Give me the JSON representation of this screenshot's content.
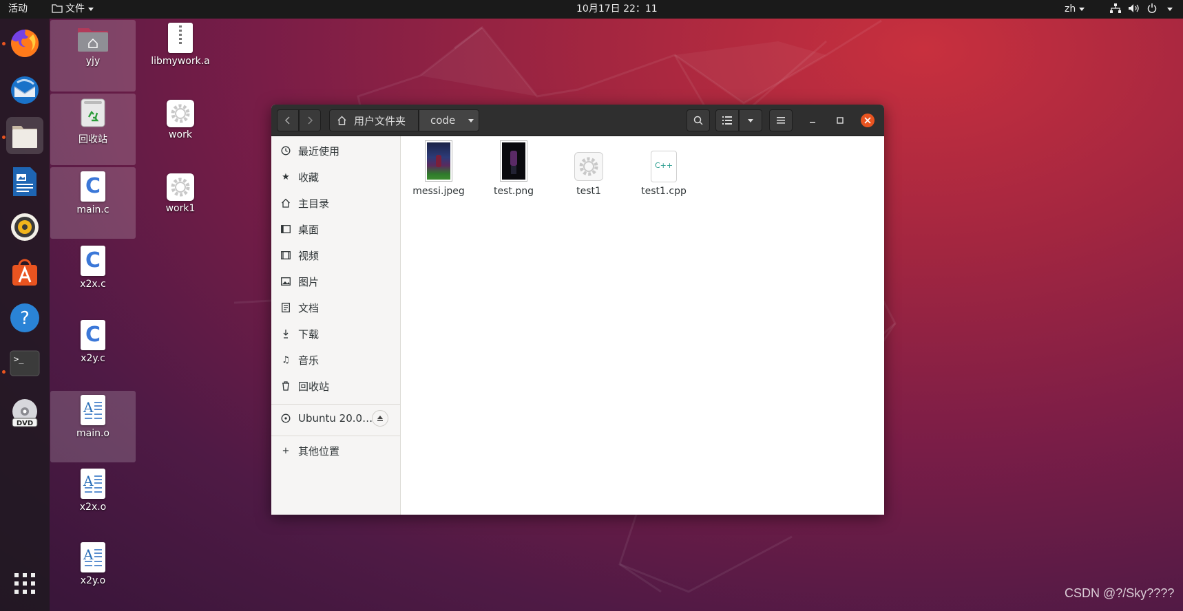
{
  "topbar": {
    "activities": "活动",
    "app_menu": "文件",
    "clock": "10月17日  22：11",
    "input_method": "zh"
  },
  "dock": {
    "items": [
      "firefox-icon",
      "thunderbird-icon",
      "files-icon",
      "writer-icon",
      "rhythmbox-icon",
      "software-icon",
      "help-icon",
      "terminal-icon",
      "dvd-icon"
    ],
    "show_apps": "show-apps-icon"
  },
  "desktop": {
    "items": [
      {
        "label": "yjy",
        "icon": "home-folder-icon"
      },
      {
        "label": "回收站",
        "icon": "trash-icon"
      },
      {
        "label": "main.c",
        "icon": "c-source-icon"
      },
      {
        "label": "x2x.c",
        "icon": "c-source-icon"
      },
      {
        "label": "x2y.c",
        "icon": "c-source-icon"
      },
      {
        "label": "main.o",
        "icon": "object-file-icon"
      },
      {
        "label": "x2x.o",
        "icon": "object-file-icon"
      },
      {
        "label": "x2y.o",
        "icon": "object-file-icon"
      },
      {
        "label": "libmywork.a",
        "icon": "archive-icon"
      },
      {
        "label": "work",
        "icon": "executable-icon"
      },
      {
        "label": "work1",
        "icon": "executable-icon"
      }
    ]
  },
  "window": {
    "path_home": "用户文件夹",
    "path_current": "code",
    "sidebar": {
      "items": [
        {
          "label": "最近使用",
          "icon": "clock-icon"
        },
        {
          "label": "收藏",
          "icon": "star-icon"
        },
        {
          "label": "主目录",
          "icon": "home-icon"
        },
        {
          "label": "桌面",
          "icon": "desktop-icon"
        },
        {
          "label": "视频",
          "icon": "video-icon"
        },
        {
          "label": "图片",
          "icon": "picture-icon"
        },
        {
          "label": "文档",
          "icon": "document-icon"
        },
        {
          "label": "下载",
          "icon": "download-icon"
        },
        {
          "label": "音乐",
          "icon": "music-icon"
        },
        {
          "label": "回收站",
          "icon": "trash-icon"
        }
      ],
      "device": "Ubuntu 20.0…",
      "other": "其他位置"
    },
    "files": [
      {
        "name": "messi.jpeg",
        "icon": "image-thumbnail-icon"
      },
      {
        "name": "test.png",
        "icon": "image-thumbnail-icon"
      },
      {
        "name": "test1",
        "icon": "executable-icon"
      },
      {
        "name": "test1.cpp",
        "icon": "cpp-source-icon"
      }
    ]
  },
  "watermark": "CSDN @?/Sky????"
}
